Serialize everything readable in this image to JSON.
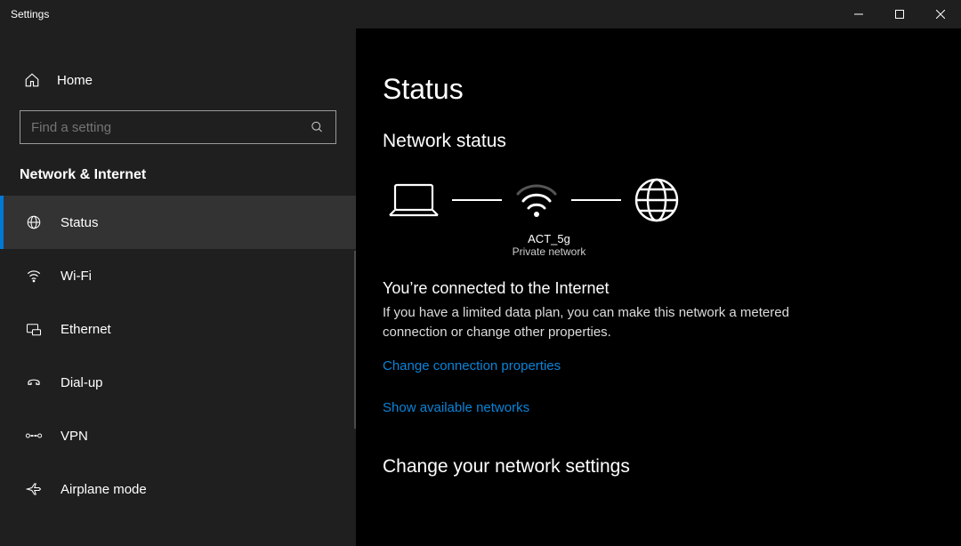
{
  "window": {
    "title": "Settings"
  },
  "sidebar": {
    "home": "Home",
    "search_placeholder": "Find a setting",
    "section": "Network & Internet",
    "items": [
      {
        "label": "Status",
        "icon": "status-icon",
        "active": true
      },
      {
        "label": "Wi-Fi",
        "icon": "wifi-icon",
        "active": false
      },
      {
        "label": "Ethernet",
        "icon": "ethernet-icon",
        "active": false
      },
      {
        "label": "Dial-up",
        "icon": "dialup-icon",
        "active": false
      },
      {
        "label": "VPN",
        "icon": "vpn-icon",
        "active": false
      },
      {
        "label": "Airplane mode",
        "icon": "airplane-icon",
        "active": false
      }
    ]
  },
  "content": {
    "title": "Status",
    "section1": "Network status",
    "network": {
      "ssid": "ACT_5g",
      "type": "Private network"
    },
    "connected_heading": "You’re connected to the Internet",
    "connected_desc": "If you have a limited data plan, you can make this network a metered connection or change other properties.",
    "link_change_props": "Change connection properties",
    "link_show_networks": "Show available networks",
    "section2": "Change your network settings"
  }
}
